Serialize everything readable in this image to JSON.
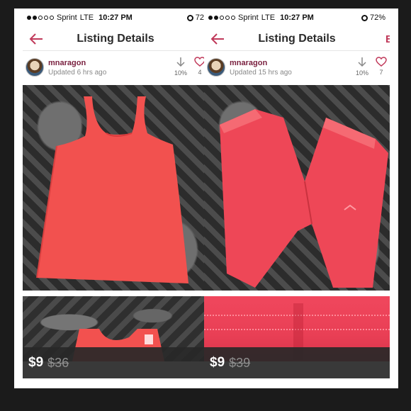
{
  "screens": [
    {
      "status": {
        "carrier": "Sprint",
        "network": "LTE",
        "time": "10:27 PM",
        "battery": "72"
      },
      "nav": {
        "title": "Listing Details"
      },
      "seller": {
        "username": "mnaragon",
        "updated": "Updated 6 hrs ago"
      },
      "stats": {
        "discount": "10%",
        "likes": "4"
      },
      "price": {
        "current": "$9",
        "original": "$36"
      },
      "icons": [
        "back-arrow-icon",
        "download-icon",
        "heart-icon"
      ],
      "item_color": "#f2514f"
    },
    {
      "status": {
        "carrier": "Sprint",
        "network": "LTE",
        "time": "10:27 PM",
        "battery": "72%"
      },
      "nav": {
        "title": "Listing Details",
        "extra": "E"
      },
      "seller": {
        "username": "mnaragon",
        "updated": "Updated 15 hrs ago"
      },
      "stats": {
        "discount": "10%",
        "likes": "7"
      },
      "price": {
        "current": "$9",
        "original": "$39"
      },
      "icons": [
        "back-arrow-icon",
        "download-icon",
        "heart-icon"
      ],
      "item_color": "#ee4757"
    }
  ],
  "colors": {
    "accent": "#c0395a",
    "price_bar": "#282828",
    "background": "#1b1b1b"
  }
}
